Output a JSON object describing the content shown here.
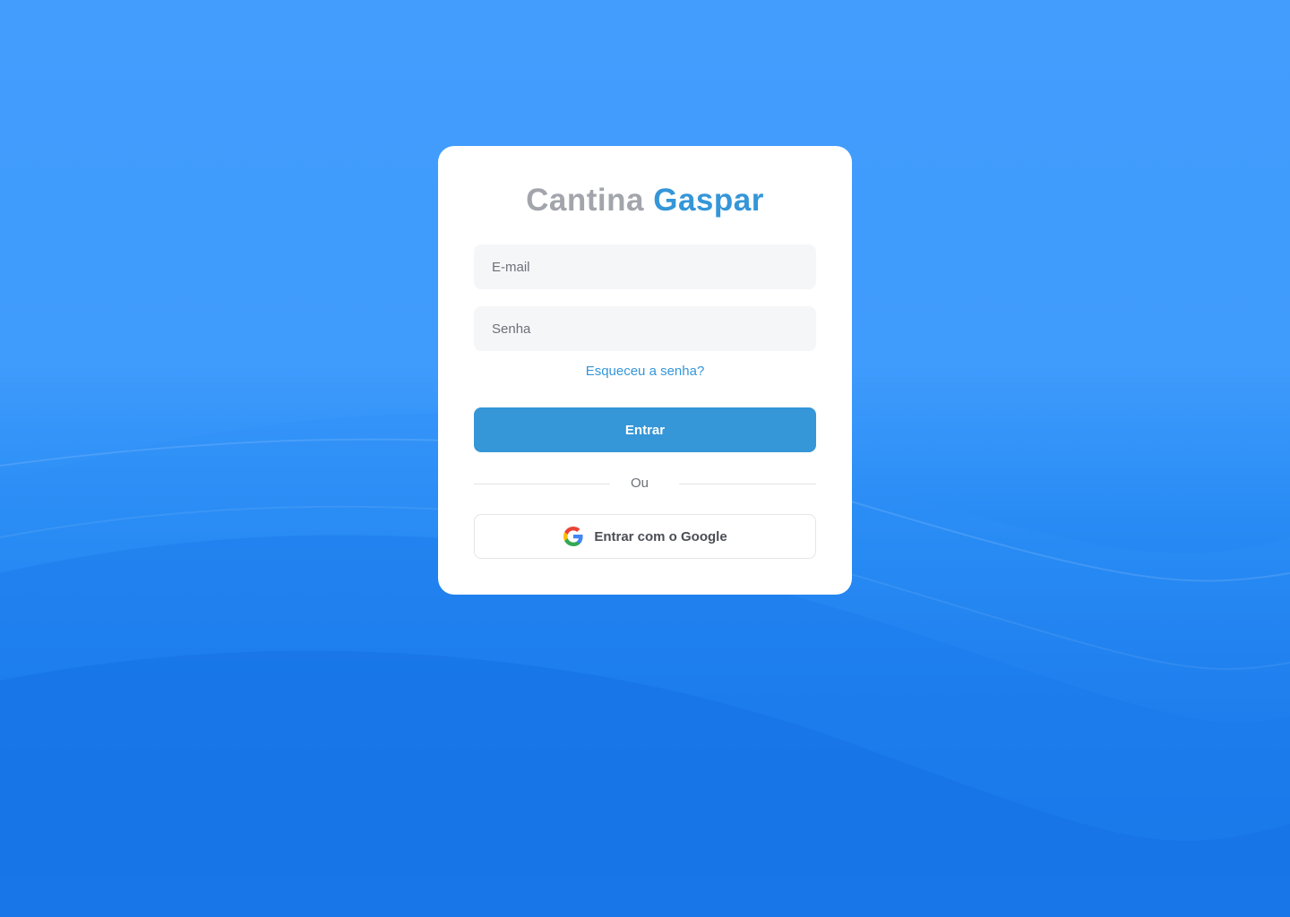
{
  "brand": {
    "first": "Cantina",
    "second": "Gaspar"
  },
  "form": {
    "email_placeholder": "E-mail",
    "password_placeholder": "Senha",
    "forgot_label": "Esqueceu a senha?",
    "submit_label": "Entrar",
    "divider_label": "Ou",
    "google_label": "Entrar com o Google"
  },
  "icons": {
    "google": "google-g-icon"
  },
  "colors": {
    "brand_primary": "#3596d8",
    "brand_muted": "#a2a5ab",
    "background_top": "#429dfd",
    "background_bottom": "#1470e4"
  }
}
